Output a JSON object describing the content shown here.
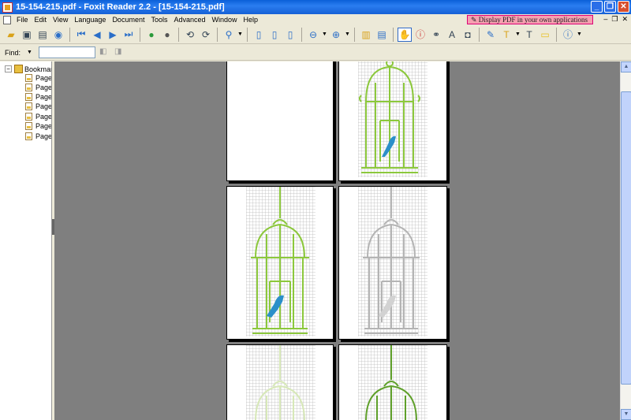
{
  "window": {
    "title": "15-154-215.pdf - Foxit Reader 2.2 - [15-154-215.pdf]"
  },
  "menu": {
    "items": [
      "File",
      "Edit",
      "View",
      "Language",
      "Document",
      "Tools",
      "Advanced",
      "Window",
      "Help"
    ],
    "promo_text": "Display PDF in your own applications"
  },
  "find": {
    "label": "Find:",
    "value": ""
  },
  "sidebar": {
    "root_label": "Bookmar",
    "items": [
      "Page",
      "Page",
      "Page",
      "Page",
      "Page",
      "Page",
      "Page"
    ]
  },
  "colors": {
    "cage_green": "#8cc83c",
    "cage_dark_green": "#5fa02a",
    "bird_blue": "#2b8fc9",
    "faded_gray": "#b4b4b4",
    "faded_green": "#d7e8b8"
  },
  "icons": [
    "open-icon",
    "save-icon",
    "print-icon",
    "email-icon",
    "first-page-icon",
    "prev-page-icon",
    "next-page-icon",
    "last-page-icon",
    "go-back-icon",
    "go-forward-icon",
    "rotate-left-icon",
    "rotate-right-icon",
    "zoom-icon",
    "actual-size-icon",
    "fit-page-icon",
    "fit-width-icon",
    "zoom-out-icon",
    "zoom-in-icon",
    "single-page-icon",
    "continuous-icon",
    "hand-tool-icon",
    "select-text-icon",
    "find-icon",
    "text-viewer-icon",
    "snapshot-icon",
    "typewriter-icon",
    "highlight-icon",
    "text-tool-icon",
    "note-icon",
    "info-icon"
  ]
}
